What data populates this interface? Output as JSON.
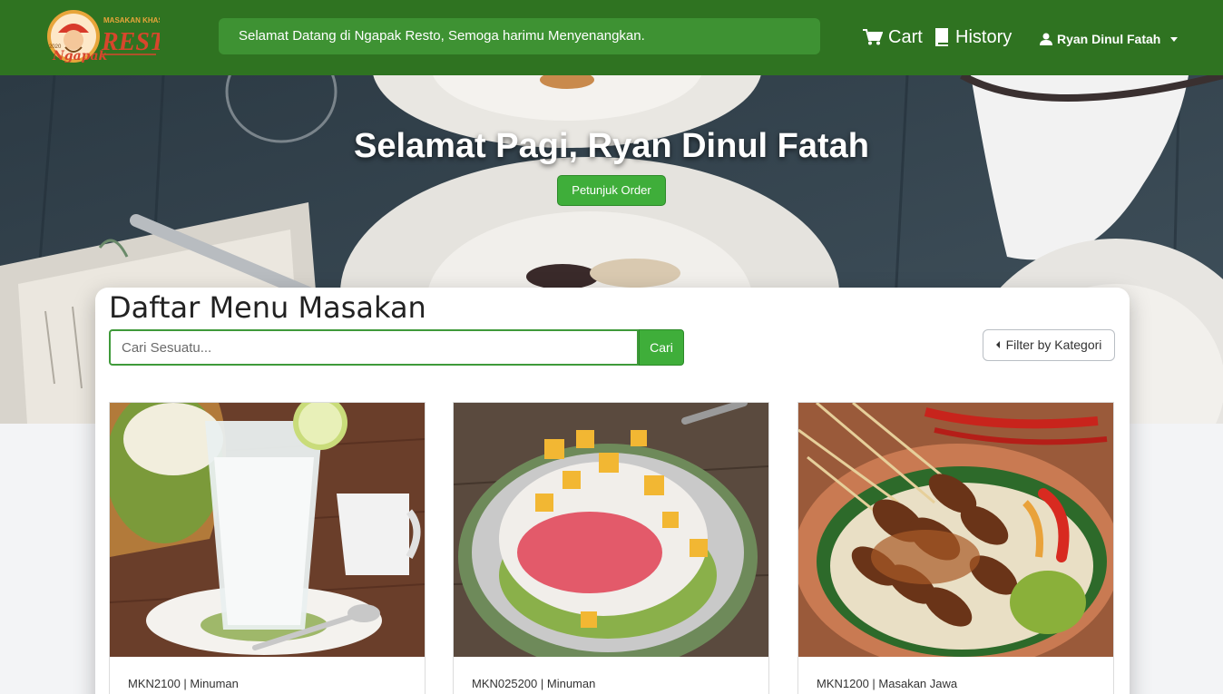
{
  "brand": {
    "logo_top": "MASAKAN KHAS",
    "logo_main": "RESTO",
    "logo_script": "Ngapak",
    "logo_year": "2020"
  },
  "navbar": {
    "welcome": "Selamat Datang di Ngapak Resto, Semoga harimu Menyenangkan.",
    "cart_label": "Cart",
    "history_label": "History",
    "user_name": "Ryan Dinul Fatah"
  },
  "hero": {
    "greeting": "Selamat Pagi, Ryan Dinul Fatah",
    "order_guide_label": "Petunjuk Order"
  },
  "menu_section": {
    "title": "Daftar Menu Masakan",
    "search_placeholder": "Cari Sesuatu...",
    "search_button": "Cari",
    "filter_label": "Filter by Kategori",
    "items": [
      {
        "code": "MKN2100",
        "category": "Minuman",
        "meta": "MKN2100 | Minuman"
      },
      {
        "code": "MKN025200",
        "category": "Minuman",
        "meta": "MKN025200 | Minuman"
      },
      {
        "code": "MKN1200",
        "category": "Masakan Jawa",
        "meta": "MKN1200 | Masakan Jawa"
      }
    ]
  },
  "colors": {
    "navbar": "#2f7321",
    "accent_green": "#3fae3a",
    "welcome_bg": "#3e9233"
  },
  "icons": [
    "cart-icon",
    "book-icon",
    "user-icon",
    "caret-down-icon",
    "caret-left-icon"
  ]
}
